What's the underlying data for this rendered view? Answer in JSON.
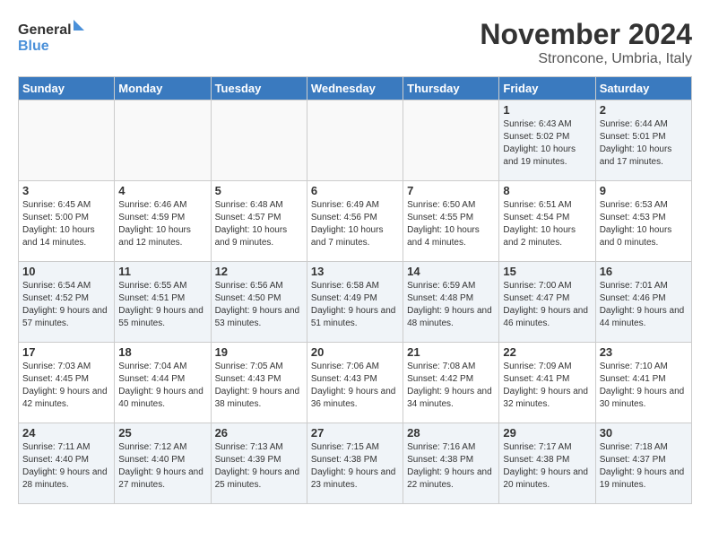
{
  "logo": {
    "line1": "General",
    "line2": "Blue"
  },
  "title": "November 2024",
  "subtitle": "Stroncone, Umbria, Italy",
  "headers": [
    "Sunday",
    "Monday",
    "Tuesday",
    "Wednesday",
    "Thursday",
    "Friday",
    "Saturday"
  ],
  "weeks": [
    [
      {
        "day": "",
        "info": ""
      },
      {
        "day": "",
        "info": ""
      },
      {
        "day": "",
        "info": ""
      },
      {
        "day": "",
        "info": ""
      },
      {
        "day": "",
        "info": ""
      },
      {
        "day": "1",
        "info": "Sunrise: 6:43 AM\nSunset: 5:02 PM\nDaylight: 10 hours and 19 minutes."
      },
      {
        "day": "2",
        "info": "Sunrise: 6:44 AM\nSunset: 5:01 PM\nDaylight: 10 hours and 17 minutes."
      }
    ],
    [
      {
        "day": "3",
        "info": "Sunrise: 6:45 AM\nSunset: 5:00 PM\nDaylight: 10 hours and 14 minutes."
      },
      {
        "day": "4",
        "info": "Sunrise: 6:46 AM\nSunset: 4:59 PM\nDaylight: 10 hours and 12 minutes."
      },
      {
        "day": "5",
        "info": "Sunrise: 6:48 AM\nSunset: 4:57 PM\nDaylight: 10 hours and 9 minutes."
      },
      {
        "day": "6",
        "info": "Sunrise: 6:49 AM\nSunset: 4:56 PM\nDaylight: 10 hours and 7 minutes."
      },
      {
        "day": "7",
        "info": "Sunrise: 6:50 AM\nSunset: 4:55 PM\nDaylight: 10 hours and 4 minutes."
      },
      {
        "day": "8",
        "info": "Sunrise: 6:51 AM\nSunset: 4:54 PM\nDaylight: 10 hours and 2 minutes."
      },
      {
        "day": "9",
        "info": "Sunrise: 6:53 AM\nSunset: 4:53 PM\nDaylight: 10 hours and 0 minutes."
      }
    ],
    [
      {
        "day": "10",
        "info": "Sunrise: 6:54 AM\nSunset: 4:52 PM\nDaylight: 9 hours and 57 minutes."
      },
      {
        "day": "11",
        "info": "Sunrise: 6:55 AM\nSunset: 4:51 PM\nDaylight: 9 hours and 55 minutes."
      },
      {
        "day": "12",
        "info": "Sunrise: 6:56 AM\nSunset: 4:50 PM\nDaylight: 9 hours and 53 minutes."
      },
      {
        "day": "13",
        "info": "Sunrise: 6:58 AM\nSunset: 4:49 PM\nDaylight: 9 hours and 51 minutes."
      },
      {
        "day": "14",
        "info": "Sunrise: 6:59 AM\nSunset: 4:48 PM\nDaylight: 9 hours and 48 minutes."
      },
      {
        "day": "15",
        "info": "Sunrise: 7:00 AM\nSunset: 4:47 PM\nDaylight: 9 hours and 46 minutes."
      },
      {
        "day": "16",
        "info": "Sunrise: 7:01 AM\nSunset: 4:46 PM\nDaylight: 9 hours and 44 minutes."
      }
    ],
    [
      {
        "day": "17",
        "info": "Sunrise: 7:03 AM\nSunset: 4:45 PM\nDaylight: 9 hours and 42 minutes."
      },
      {
        "day": "18",
        "info": "Sunrise: 7:04 AM\nSunset: 4:44 PM\nDaylight: 9 hours and 40 minutes."
      },
      {
        "day": "19",
        "info": "Sunrise: 7:05 AM\nSunset: 4:43 PM\nDaylight: 9 hours and 38 minutes."
      },
      {
        "day": "20",
        "info": "Sunrise: 7:06 AM\nSunset: 4:43 PM\nDaylight: 9 hours and 36 minutes."
      },
      {
        "day": "21",
        "info": "Sunrise: 7:08 AM\nSunset: 4:42 PM\nDaylight: 9 hours and 34 minutes."
      },
      {
        "day": "22",
        "info": "Sunrise: 7:09 AM\nSunset: 4:41 PM\nDaylight: 9 hours and 32 minutes."
      },
      {
        "day": "23",
        "info": "Sunrise: 7:10 AM\nSunset: 4:41 PM\nDaylight: 9 hours and 30 minutes."
      }
    ],
    [
      {
        "day": "24",
        "info": "Sunrise: 7:11 AM\nSunset: 4:40 PM\nDaylight: 9 hours and 28 minutes."
      },
      {
        "day": "25",
        "info": "Sunrise: 7:12 AM\nSunset: 4:40 PM\nDaylight: 9 hours and 27 minutes."
      },
      {
        "day": "26",
        "info": "Sunrise: 7:13 AM\nSunset: 4:39 PM\nDaylight: 9 hours and 25 minutes."
      },
      {
        "day": "27",
        "info": "Sunrise: 7:15 AM\nSunset: 4:38 PM\nDaylight: 9 hours and 23 minutes."
      },
      {
        "day": "28",
        "info": "Sunrise: 7:16 AM\nSunset: 4:38 PM\nDaylight: 9 hours and 22 minutes."
      },
      {
        "day": "29",
        "info": "Sunrise: 7:17 AM\nSunset: 4:38 PM\nDaylight: 9 hours and 20 minutes."
      },
      {
        "day": "30",
        "info": "Sunrise: 7:18 AM\nSunset: 4:37 PM\nDaylight: 9 hours and 19 minutes."
      }
    ]
  ]
}
